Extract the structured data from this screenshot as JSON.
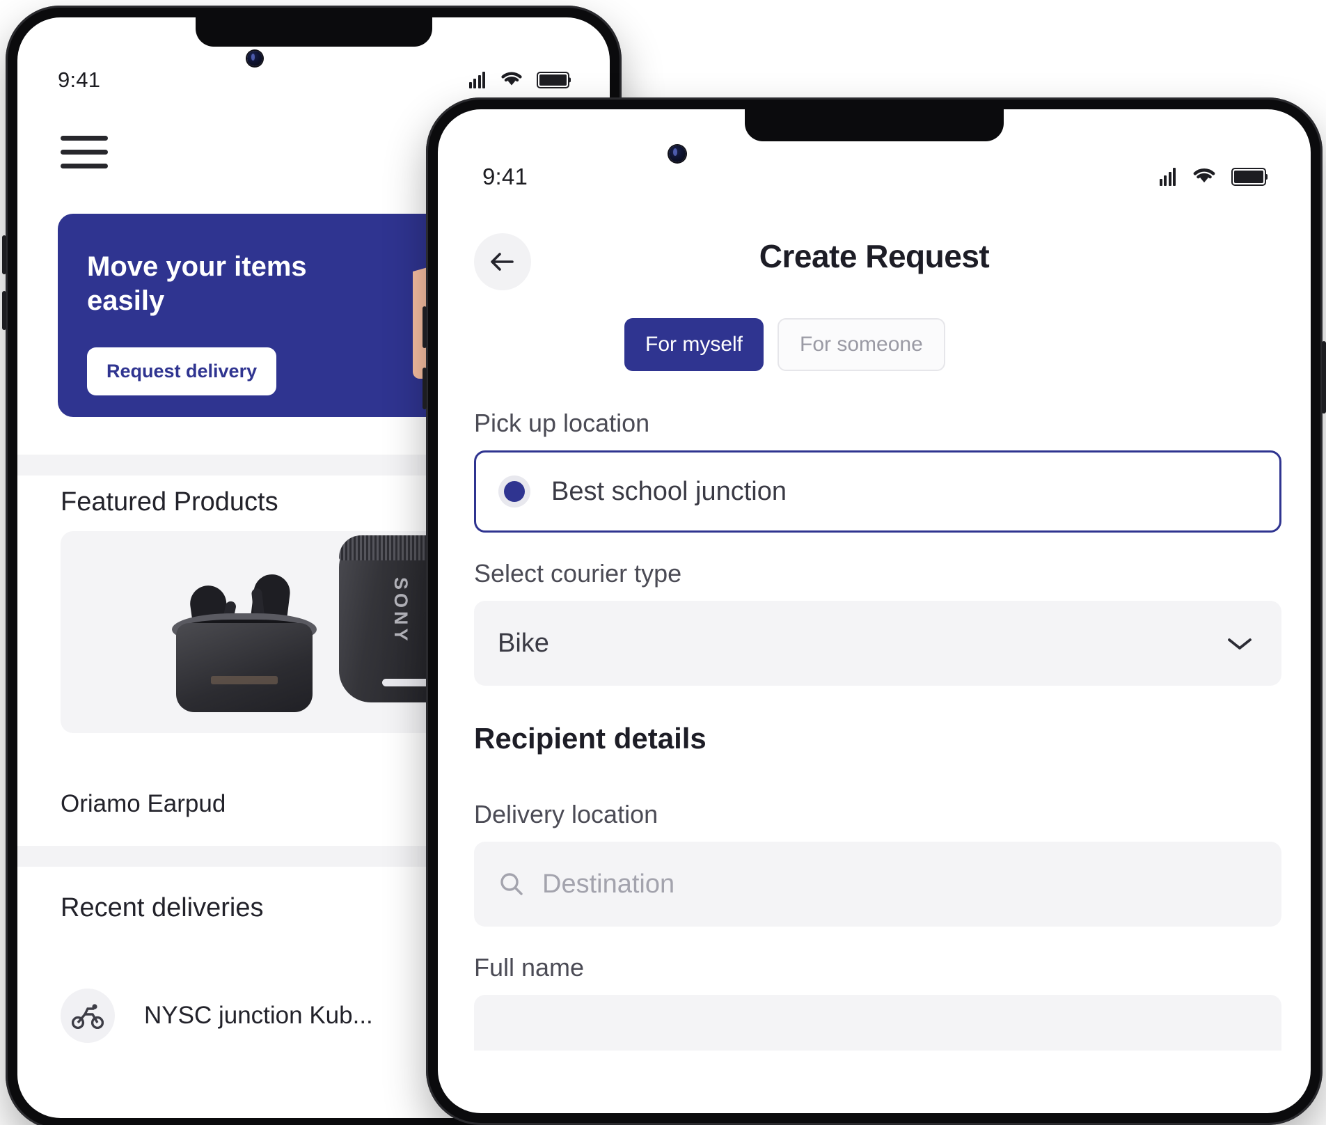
{
  "phone_home": {
    "status": {
      "time": "9:41",
      "signal_icon": "cellular-bars-icon",
      "wifi_icon": "wifi-icon",
      "battery_icon": "battery-full-icon"
    },
    "menu_icon": "hamburger-menu-icon",
    "promo": {
      "title": "Move your items easily",
      "cta_label": "Request delivery",
      "art_icon": "package-box-icon",
      "background_color": "#2F3490"
    },
    "featured": {
      "heading": "Featured Products",
      "product_image_icons": [
        "earbuds-icon",
        "bluetooth-speaker-icon"
      ],
      "product_name": "Oriamo Earpud",
      "product_price": "₦",
      "speaker_brand": "SONY"
    },
    "recent": {
      "heading": "Recent deliveries",
      "items": [
        {
          "icon": "motorcycle-courier-icon",
          "label": "NYSC junction Kub..."
        }
      ]
    }
  },
  "phone_create": {
    "status": {
      "time": "9:41",
      "signal_icon": "cellular-bars-icon",
      "wifi_icon": "wifi-icon",
      "battery_icon": "battery-full-icon"
    },
    "header": {
      "back_icon": "arrow-left-icon",
      "title": "Create Request"
    },
    "segmented": {
      "options": [
        {
          "label": "For myself",
          "selected": true
        },
        {
          "label": "For someone",
          "selected": false
        }
      ],
      "active_color": "#2F3490"
    },
    "pickup": {
      "label": "Pick up location",
      "selected_value": "Best school junction",
      "radio_icon": "radio-selected-icon"
    },
    "courier": {
      "label": "Select courier type",
      "value": "Bike",
      "chevron_icon": "chevron-down-icon"
    },
    "recipient": {
      "section_title": "Recipient details",
      "delivery_label": "Delivery location",
      "destination_placeholder": "Destination",
      "search_icon": "search-icon",
      "fullname_label": "Full name"
    }
  }
}
